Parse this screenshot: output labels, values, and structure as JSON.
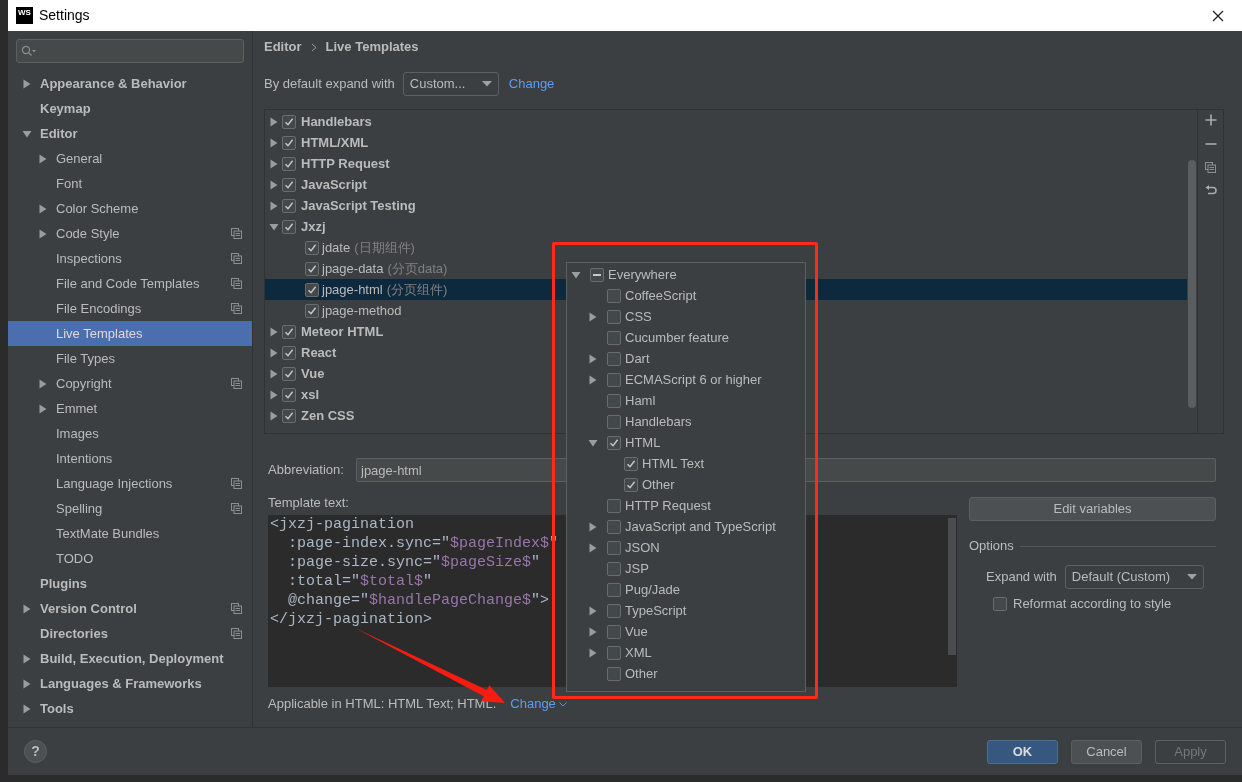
{
  "window": {
    "logo": "WS",
    "title": "Settings"
  },
  "sidebar": {
    "items": [
      {
        "label": "Appearance & Behavior",
        "expanded": false,
        "selected": false,
        "project_level": false
      },
      {
        "label": "Keymap",
        "selected": false,
        "project_level": false
      },
      {
        "label": "Editor",
        "expanded": true,
        "selected": false,
        "project_level": false,
        "children": [
          {
            "label": "General",
            "expanded": false,
            "selected": false,
            "project_level": false
          },
          {
            "label": "Font",
            "selected": false,
            "project_level": false
          },
          {
            "label": "Color Scheme",
            "expanded": false,
            "selected": false,
            "project_level": false
          },
          {
            "label": "Code Style",
            "expanded": false,
            "selected": false,
            "project_level": true
          },
          {
            "label": "Inspections",
            "selected": false,
            "project_level": true
          },
          {
            "label": "File and Code Templates",
            "selected": false,
            "project_level": true
          },
          {
            "label": "File Encodings",
            "selected": false,
            "project_level": true
          },
          {
            "label": "Live Templates",
            "selected": true,
            "project_level": false
          },
          {
            "label": "File Types",
            "selected": false,
            "project_level": false
          },
          {
            "label": "Copyright",
            "expanded": false,
            "selected": false,
            "project_level": true
          },
          {
            "label": "Emmet",
            "expanded": false,
            "selected": false,
            "project_level": false
          },
          {
            "label": "Images",
            "selected": false,
            "project_level": false
          },
          {
            "label": "Intentions",
            "selected": false,
            "project_level": false
          },
          {
            "label": "Language Injections",
            "selected": false,
            "project_level": true
          },
          {
            "label": "Spelling",
            "selected": false,
            "project_level": true
          },
          {
            "label": "TextMate Bundles",
            "selected": false,
            "project_level": false
          },
          {
            "label": "TODO",
            "selected": false,
            "project_level": false
          }
        ]
      },
      {
        "label": "Plugins",
        "selected": false,
        "project_level": false
      },
      {
        "label": "Version Control",
        "expanded": false,
        "selected": false,
        "project_level": true
      },
      {
        "label": "Directories",
        "selected": false,
        "project_level": true
      },
      {
        "label": "Build, Execution, Deployment",
        "expanded": false,
        "selected": false,
        "project_level": false
      },
      {
        "label": "Languages & Frameworks",
        "expanded": false,
        "selected": false,
        "project_level": false
      },
      {
        "label": "Tools",
        "expanded": false,
        "selected": false,
        "project_level": false
      }
    ]
  },
  "breadcrumb": [
    "Editor",
    "Live Templates"
  ],
  "expand_default": {
    "label": "By default expand with",
    "value": "Custom...",
    "link": "Change"
  },
  "template_groups": [
    {
      "label": "Handlebars",
      "checked": true,
      "expanded": false,
      "selected": false
    },
    {
      "label": "HTML/XML",
      "checked": true,
      "expanded": false,
      "selected": false
    },
    {
      "label": "HTTP Request",
      "checked": true,
      "expanded": false,
      "selected": false
    },
    {
      "label": "JavaScript",
      "checked": true,
      "expanded": false,
      "selected": false
    },
    {
      "label": "JavaScript Testing",
      "checked": true,
      "expanded": false,
      "selected": false
    },
    {
      "label": "Jxzj",
      "checked": true,
      "expanded": true,
      "selected": false,
      "children": [
        {
          "label": "jdate",
          "description": "(日期组件)",
          "checked": true,
          "selected": false
        },
        {
          "label": "jpage-data",
          "description": "(分页data)",
          "checked": true,
          "selected": false
        },
        {
          "label": "jpage-html",
          "description": "(分页组件)",
          "checked": true,
          "selected": true
        },
        {
          "label": "jpage-method",
          "checked": true,
          "selected": false
        }
      ]
    },
    {
      "label": "Meteor HTML",
      "checked": true,
      "expanded": false,
      "selected": false
    },
    {
      "label": "React",
      "checked": true,
      "expanded": false,
      "selected": false
    },
    {
      "label": "Vue",
      "checked": true,
      "expanded": false,
      "selected": false
    },
    {
      "label": "xsl",
      "checked": true,
      "expanded": false,
      "selected": false
    },
    {
      "label": "Zen CSS",
      "checked": true,
      "expanded": false,
      "selected": false
    }
  ],
  "abbreviation": {
    "label": "Abbreviation:",
    "value": "jpage-html"
  },
  "template_text": {
    "label": "Template text:",
    "lines": [
      [
        {
          "text": "<jxzj-pagination",
          "kind": "plain"
        }
      ],
      [
        {
          "text": "  :page-index.sync=\"",
          "kind": "plain"
        },
        {
          "text": "$pageIndex$",
          "kind": "variable"
        },
        {
          "text": "\"",
          "kind": "plain"
        }
      ],
      [
        {
          "text": "  :page-size.sync=\"",
          "kind": "plain"
        },
        {
          "text": "$pageSize$",
          "kind": "variable"
        },
        {
          "text": "\"",
          "kind": "plain"
        }
      ],
      [
        {
          "text": "  :total=\"",
          "kind": "plain"
        },
        {
          "text": "$total$",
          "kind": "variable"
        },
        {
          "text": "\"",
          "kind": "plain"
        }
      ],
      [
        {
          "text": "  @change=\"",
          "kind": "plain"
        },
        {
          "text": "$handlePageChange$",
          "kind": "variable"
        },
        {
          "text": "\">",
          "kind": "plain"
        }
      ],
      [
        {
          "text": "</jxzj-pagination>",
          "kind": "plain"
        }
      ]
    ]
  },
  "edit_variables": "Edit variables",
  "options": {
    "title": "Options",
    "expand_label": "Expand with",
    "expand_value": "Default (Custom)",
    "reformat": {
      "label": "Reformat according to style",
      "checked": false
    }
  },
  "applicable": {
    "text": "Applicable in HTML: HTML Text; HTML.",
    "link": "Change"
  },
  "context_popup": {
    "items": [
      {
        "label": "Everywhere",
        "checked": true,
        "mixed": true,
        "expanded": true,
        "children": [
          {
            "label": "CoffeeScript",
            "checked": false
          },
          {
            "label": "CSS",
            "checked": false,
            "expanded": false
          },
          {
            "label": "Cucumber feature",
            "checked": false
          },
          {
            "label": "Dart",
            "checked": false,
            "expanded": false
          },
          {
            "label": "ECMAScript 6 or higher",
            "checked": false,
            "expanded": false
          },
          {
            "label": "Haml",
            "checked": false
          },
          {
            "label": "Handlebars",
            "checked": false
          },
          {
            "label": "HTML",
            "checked": true,
            "expanded": true,
            "children": [
              {
                "label": "HTML Text",
                "checked": true
              },
              {
                "label": "Other",
                "checked": true
              }
            ]
          },
          {
            "label": "HTTP Request",
            "checked": false
          },
          {
            "label": "JavaScript and TypeScript",
            "checked": false,
            "expanded": false
          },
          {
            "label": "JSON",
            "checked": false,
            "expanded": false
          },
          {
            "label": "JSP",
            "checked": false
          },
          {
            "label": "Pug/Jade",
            "checked": false
          },
          {
            "label": "TypeScript",
            "checked": false,
            "expanded": false
          },
          {
            "label": "Vue",
            "checked": false,
            "expanded": false
          },
          {
            "label": "XML",
            "checked": false,
            "expanded": false
          },
          {
            "label": "Other",
            "checked": false
          }
        ]
      }
    ]
  },
  "footer": {
    "help": "?",
    "buttons": [
      {
        "label": "OK",
        "kind": "primary"
      },
      {
        "label": "Cancel",
        "kind": "normal"
      },
      {
        "label": "Apply",
        "kind": "disabled"
      }
    ]
  }
}
